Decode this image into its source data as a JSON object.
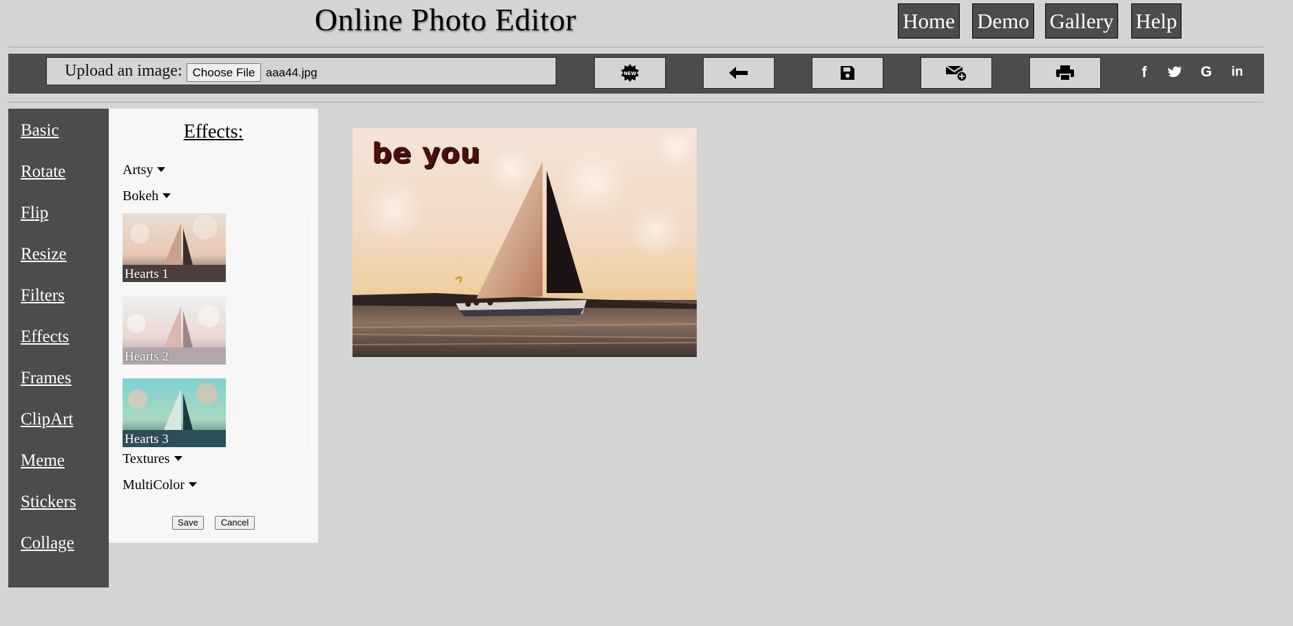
{
  "header": {
    "title": "Online Photo Editor",
    "nav": [
      {
        "label": "Home"
      },
      {
        "label": "Demo"
      },
      {
        "label": "Gallery"
      },
      {
        "label": "Help"
      }
    ]
  },
  "toolbar": {
    "upload_label": "Upload an image:",
    "choose_file_label": "Choose File",
    "file_name": "aaa44.jpg",
    "tools": [
      {
        "icon": "new-badge-icon",
        "badge_text": "NEW"
      },
      {
        "icon": "back-arrow-icon"
      },
      {
        "icon": "save-icon"
      },
      {
        "icon": "email-icon"
      },
      {
        "icon": "print-icon"
      }
    ],
    "social": [
      {
        "icon": "facebook-icon",
        "glyph": "f"
      },
      {
        "icon": "twitter-icon",
        "glyph": "t"
      },
      {
        "icon": "google-icon",
        "glyph": "G"
      },
      {
        "icon": "linkedin-icon",
        "glyph": "in"
      }
    ]
  },
  "sidebar": {
    "items": [
      {
        "label": "Basic"
      },
      {
        "label": "Rotate"
      },
      {
        "label": "Flip"
      },
      {
        "label": "Resize"
      },
      {
        "label": "Filters"
      },
      {
        "label": "Effects"
      },
      {
        "label": "Frames"
      },
      {
        "label": "ClipArt"
      },
      {
        "label": "Meme"
      },
      {
        "label": "Stickers"
      },
      {
        "label": "Collage"
      }
    ]
  },
  "effects_panel": {
    "title": "Effects:",
    "categories": [
      {
        "label": "Artsy"
      },
      {
        "label": "Bokeh"
      },
      {
        "label": "Textures"
      },
      {
        "label": "MultiColor"
      }
    ],
    "thumbnails": [
      {
        "label": "Hearts 1"
      },
      {
        "label": "Hearts 2"
      },
      {
        "label": "Hearts 3"
      }
    ],
    "save_label": "Save",
    "cancel_label": "Cancel"
  },
  "canvas": {
    "overlay_text": "be you"
  },
  "colors": {
    "background": "#d3d4d4",
    "bar": "#4c4c4c",
    "panel": "#f7f7f7"
  }
}
